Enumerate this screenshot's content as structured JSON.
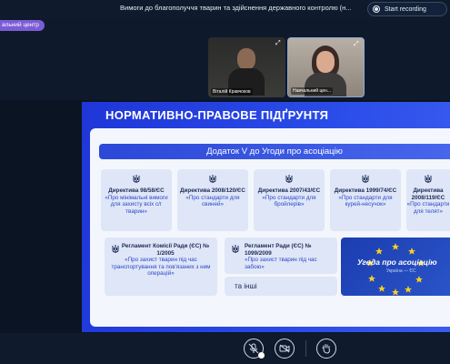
{
  "topbar": {
    "meeting_title": "Вимоги до благополуччя тварин та здійснення державного контролю (н...",
    "record_label": "Start recording"
  },
  "participant_tag": "альний центр",
  "participants": [
    {
      "name": "Віталій Кравчоков"
    },
    {
      "name": "Навчальний цен..."
    }
  ],
  "slide": {
    "title": "НОРМАТИВНО-ПРАВОВЕ ПІДҐРУНТЯ",
    "banner": "Додаток V до Угоди про асоціацію",
    "directives": [
      {
        "title": "Директива 98/58/ЄС",
        "desc": "«Про мінімальні вимоги для захисту всіх с/г тварин»"
      },
      {
        "title": "Директива 2008/120/ЄС",
        "desc": "«Про стандарти для свиней»"
      },
      {
        "title": "Директива 2007/43/ЄС",
        "desc": "«Про стандарти для бройлерів»"
      },
      {
        "title": "Директива 1999/74/ЄС",
        "desc": "«Про стандарти для курей-несучок»"
      },
      {
        "title": "Директива 2008/119/ЄС",
        "desc": "«Про стандарти для телят»"
      }
    ],
    "regulation1": {
      "title": "Регламент Комісії Ради (ЄС) № 1/2005",
      "desc": "«Про захист тварин під час транспортування та пов'язаних з ним операцій»"
    },
    "regulation2": {
      "title": "Регламент Ради (ЄС) № 1099/2009",
      "desc": "«Про захист тварин під час забою»"
    },
    "other": "та інші",
    "eu_title": "Угода про асоціацію",
    "eu_sub": "Україна — ЄС"
  },
  "controls": [
    {
      "icon": "microphone-muted-icon"
    },
    {
      "icon": "camera-off-icon"
    },
    {
      "icon": "raise-hand-icon"
    }
  ],
  "colors": {
    "accent": "#7b5cd6",
    "slide_blue": "#2a4be8",
    "card_bg": "#dfe6f7"
  }
}
